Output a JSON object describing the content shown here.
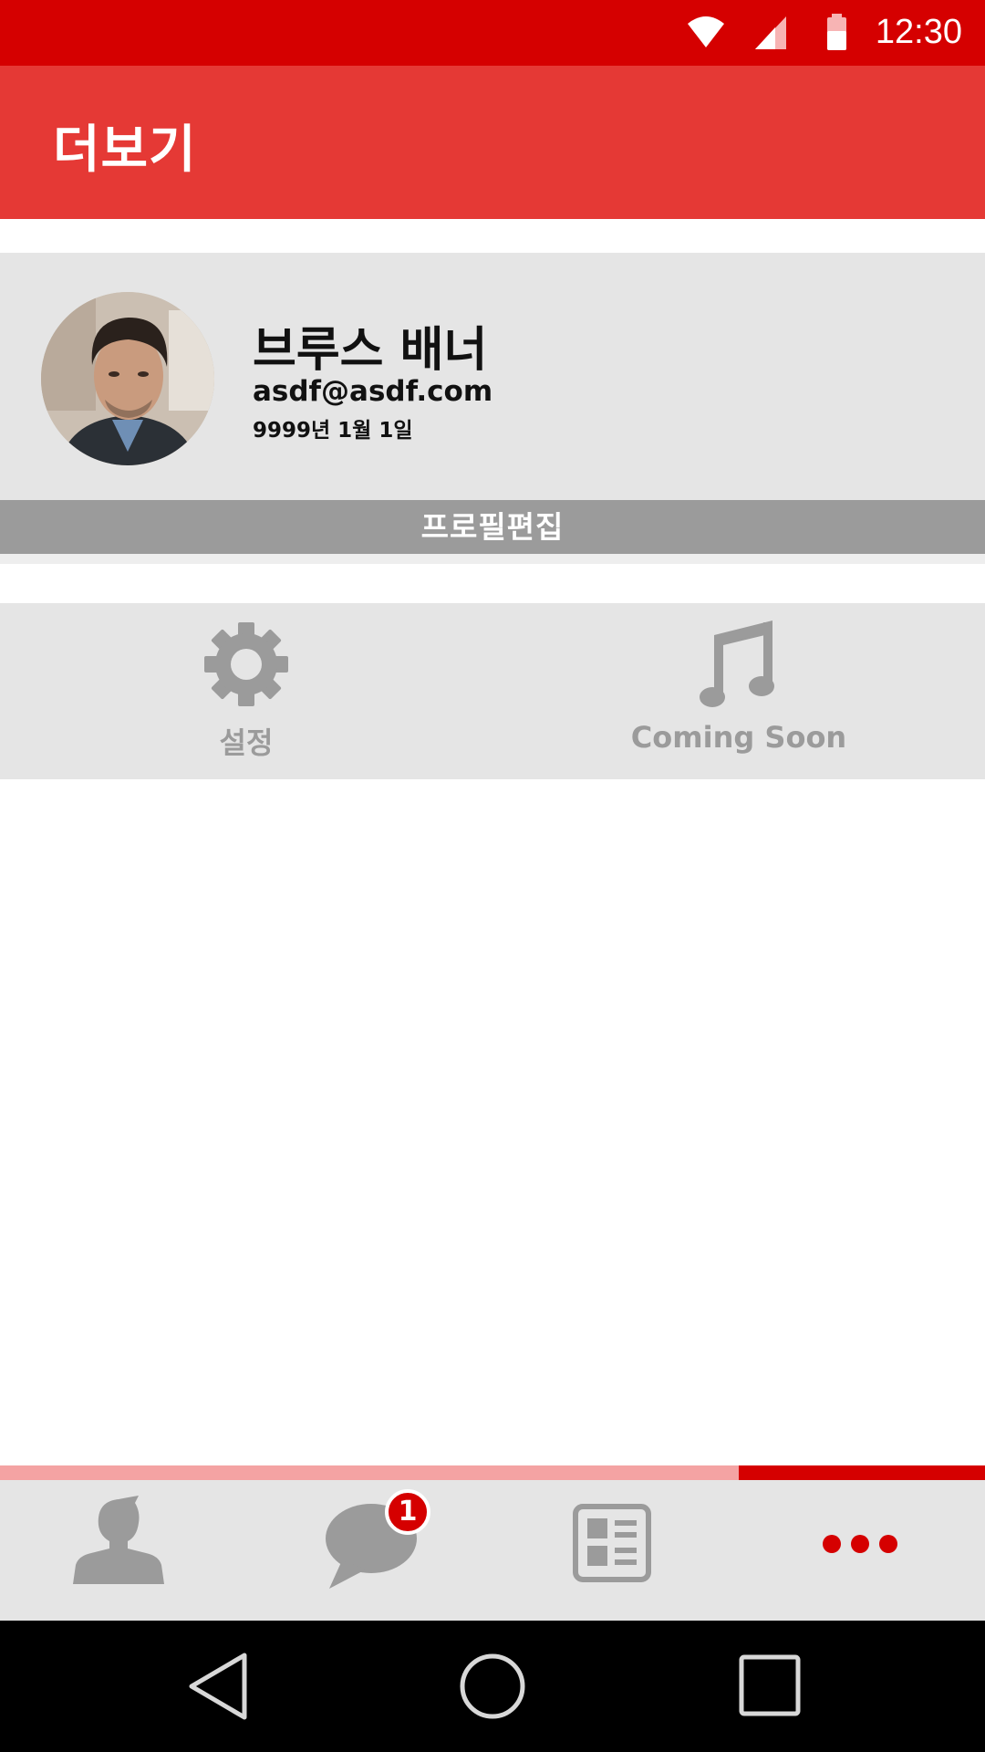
{
  "status_bar": {
    "time": "12:30",
    "icons": [
      "wifi-icon",
      "cell-signal-icon",
      "battery-icon"
    ],
    "background": "#d50000"
  },
  "app_bar": {
    "title": "더보기",
    "background": "#e53935"
  },
  "profile": {
    "name": "브루스 배너",
    "email": "asdf@asdf.com",
    "birthdate": "9999년 1월 1일",
    "edit_label": "프로필편집"
  },
  "menu": {
    "items": [
      {
        "label": "설정",
        "icon": "gear-icon"
      },
      {
        "label": "Coming Soon",
        "icon": "music-note-icon"
      }
    ]
  },
  "bottom_tabs": {
    "items": [
      {
        "icon": "person-icon"
      },
      {
        "icon": "chat-bubble-icon",
        "badge": "1"
      },
      {
        "icon": "news-list-icon"
      },
      {
        "icon": "more-dots-icon",
        "active": true
      }
    ],
    "active_color": "#d50000",
    "inactive_color": "#9b9b9b"
  },
  "nav_bar": {
    "buttons": [
      "back-icon",
      "home-icon",
      "recents-icon"
    ]
  }
}
